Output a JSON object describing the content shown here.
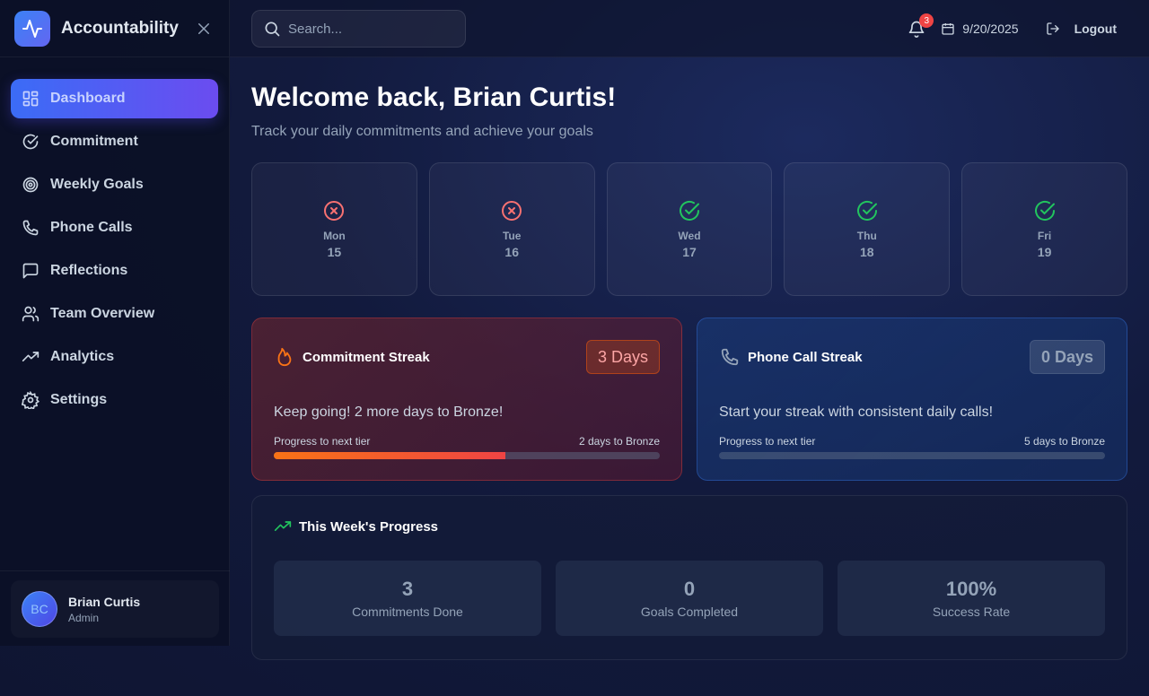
{
  "brand": {
    "name": "Accountability"
  },
  "sidebar": {
    "items": [
      {
        "label": "Dashboard",
        "icon": "dashboard-icon",
        "active": true
      },
      {
        "label": "Commitment",
        "icon": "check-circle-icon"
      },
      {
        "label": "Weekly Goals",
        "icon": "target-icon"
      },
      {
        "label": "Phone Calls",
        "icon": "phone-icon"
      },
      {
        "label": "Reflections",
        "icon": "message-icon"
      },
      {
        "label": "Team Overview",
        "icon": "users-icon"
      },
      {
        "label": "Analytics",
        "icon": "trending-up-icon"
      },
      {
        "label": "Settings",
        "icon": "gear-icon"
      }
    ]
  },
  "user": {
    "initials": "BC",
    "name": "Brian Curtis",
    "role": "Admin"
  },
  "topbar": {
    "search_placeholder": "Search...",
    "notification_count": "3",
    "date": "9/20/2025",
    "logout_label": "Logout"
  },
  "main": {
    "welcome": "Welcome back, Brian Curtis!",
    "subtitle": "Track your daily commitments and achieve your goals",
    "days": [
      {
        "name": "Mon",
        "num": "15",
        "status": "missed"
      },
      {
        "name": "Tue",
        "num": "16",
        "status": "missed"
      },
      {
        "name": "Wed",
        "num": "17",
        "status": "done"
      },
      {
        "name": "Thu",
        "num": "18",
        "status": "done"
      },
      {
        "name": "Fri",
        "num": "19",
        "status": "done"
      }
    ],
    "commitment_streak": {
      "title": "Commitment Streak",
      "badge": "3 Days",
      "message": "Keep going! 2 more days to Bronze!",
      "progress_label": "Progress to next tier",
      "progress_right": "2 days to Bronze",
      "progress": 0.6
    },
    "phone_streak": {
      "title": "Phone Call Streak",
      "badge": "0 Days",
      "message": "Start your streak with consistent daily calls!",
      "progress_label": "Progress to next tier",
      "progress_right": "5 days to Bronze",
      "progress": 0
    },
    "weekly": {
      "title": "This Week's Progress",
      "stats": [
        {
          "value": "3",
          "label": "Commitments Done"
        },
        {
          "value": "0",
          "label": "Goals Completed"
        },
        {
          "value": "100%",
          "label": "Success Rate"
        }
      ]
    }
  },
  "colors": {
    "accent": "#4f46e5",
    "missed": "#f87171",
    "done": "#22c55e",
    "flame": "#f97316",
    "trend": "#22c55e"
  }
}
